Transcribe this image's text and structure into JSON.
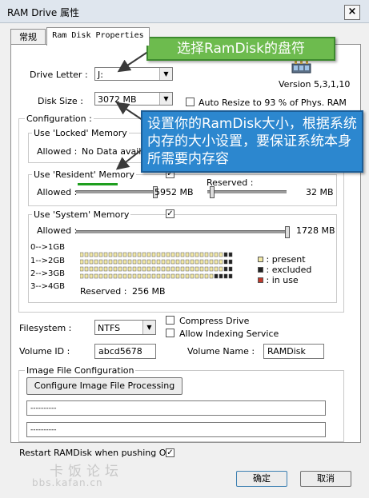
{
  "window": {
    "title": "RAM Drive 属性",
    "close": "×"
  },
  "tabs": [
    {
      "label": "常规"
    },
    {
      "label": "Ram Disk Properties"
    }
  ],
  "drive_letter": {
    "label": "Drive Letter :",
    "value": "J:"
  },
  "version": "Version  5,3,1,10",
  "disk_size": {
    "label": "Disk Size :",
    "value": "3072 MB"
  },
  "auto_resize": "Auto Resize to  93 % of Phys. RAM",
  "configuration": {
    "title": "Configuration :",
    "locked": {
      "title": "Use 'Locked' Memory",
      "allowed_label": "Allowed :",
      "allowed_value": "No Data availab"
    },
    "resident": {
      "title": "Use 'Resident' Memory",
      "check": "✓",
      "allowed_label": "Allowed :",
      "allowed_value": "5952 MB",
      "reserved_label": "Reserved :",
      "reserved_value": "32 MB"
    },
    "system": {
      "title": "Use 'System' Memory",
      "check": "✓",
      "allowed_label": "Allowed :",
      "allowed_value": "1728 MB",
      "rows": [
        "0-->1GB",
        "1-->2GB",
        "2-->3GB",
        "3-->4GB"
      ],
      "reserved_label": "Reserved :",
      "reserved_value": "256 MB",
      "legend": [
        {
          "label": ": present",
          "color": "#f3e9a6"
        },
        {
          "label": ": excluded",
          "color": "#222222"
        },
        {
          "label": ": in use",
          "color": "#c0392b"
        }
      ]
    }
  },
  "filesystem": {
    "label": "Filesystem :",
    "value": "NTFS"
  },
  "compress_drive": "Compress Drive",
  "allow_indexing": "Allow Indexing Service",
  "volume_id": {
    "label": "Volume ID :",
    "value": "abcd5678"
  },
  "volume_name": {
    "label": "Volume Name :",
    "value": "RAMDisk"
  },
  "image_file": {
    "title": "Image File Configuration",
    "button": "Configure Image File Processing",
    "field1": "----------",
    "field2": "----------"
  },
  "restart": {
    "label": "Restart RAMDisk when pushing OK",
    "check": "✓"
  },
  "buttons": {
    "ok": "确定",
    "cancel": "取消"
  },
  "callouts": {
    "drive": "选择RamDisk的盘符",
    "size": "设置你的RamDisk大小，根据系统内存的大小设置，要保证系统本身所需要内存容"
  },
  "watermark": {
    "line1": "卡饭论坛",
    "line2": "bbs.kafan.cn"
  },
  "colors": {
    "callout_green": "#6dbb4e",
    "callout_blue": "#2c87cf",
    "resident_bar": "#1e9e1e"
  }
}
